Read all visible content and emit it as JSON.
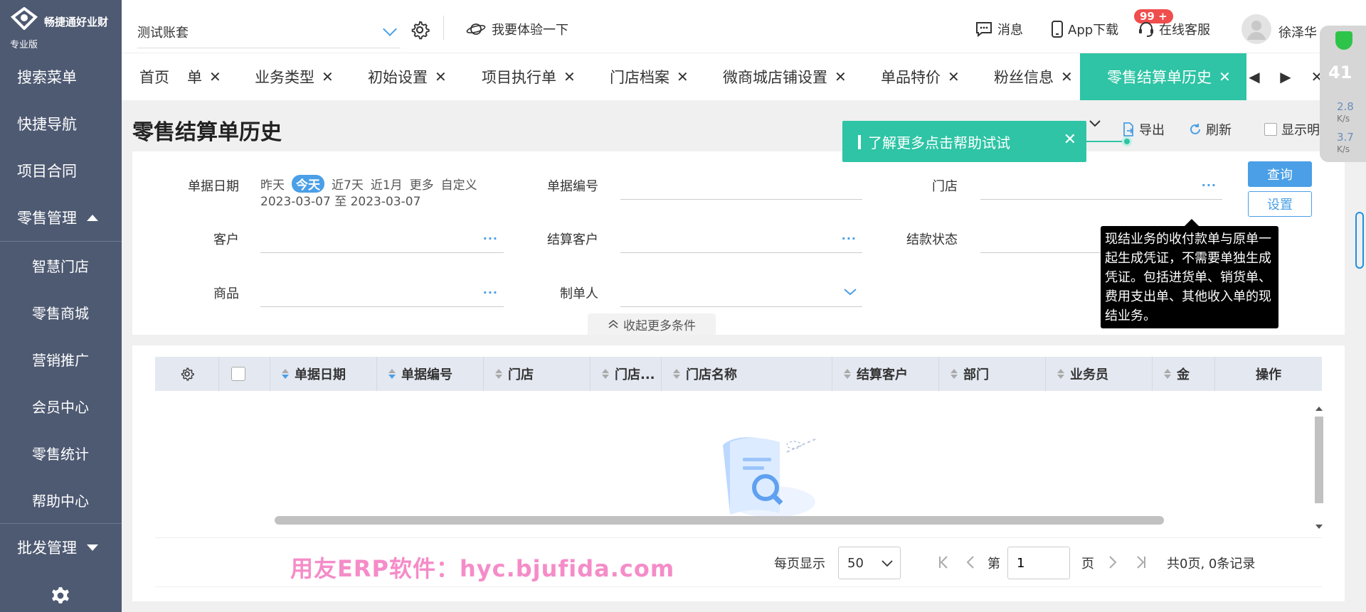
{
  "brand": {
    "name": "畅捷通好业财",
    "edition": "专业版"
  },
  "sidebar": {
    "items": [
      {
        "label": "搜索菜单"
      },
      {
        "label": "快捷导航"
      },
      {
        "label": "项目合同"
      },
      {
        "label": "零售管理"
      },
      {
        "label": "智慧门店"
      },
      {
        "label": "零售商城"
      },
      {
        "label": "营销推广"
      },
      {
        "label": "会员中心"
      },
      {
        "label": "零售统计"
      },
      {
        "label": "帮助中心"
      },
      {
        "label": "批发管理"
      }
    ]
  },
  "header": {
    "account": "测试账套",
    "try": "我要体验一下",
    "messages": "消息",
    "badge": "99 +",
    "app": "App下载",
    "service": "在线客服",
    "user": "徐泽华"
  },
  "tabs": {
    "items": [
      {
        "label": "首页"
      },
      {
        "label": "单"
      },
      {
        "label": "业务类型"
      },
      {
        "label": "初始设置"
      },
      {
        "label": "项目执行单"
      },
      {
        "label": "门店档案"
      },
      {
        "label": "微商城店铺设置"
      },
      {
        "label": "单品特价"
      },
      {
        "label": "粉丝信息"
      },
      {
        "label": "零售结算单历史"
      }
    ]
  },
  "page": {
    "title": "零售结算单历史",
    "export": "导出",
    "refresh": "刷新",
    "show_detail": "显示明细"
  },
  "tip": {
    "text": "了解更多点击帮助试试",
    "close": "✕"
  },
  "filter": {
    "date_label": "单据日期",
    "date_options": [
      "昨天",
      "今天",
      "近7天",
      "近1月",
      "更多",
      "自定义"
    ],
    "date_range": "2023-03-07 至 2023-03-07",
    "doc_no_label": "单据编号",
    "store_label": "门店",
    "customer_label": "客户",
    "settle_customer_label": "结算客户",
    "settle_status_label": "结款状态",
    "product_label": "商品",
    "creator_label": "制单人",
    "query": "查询",
    "setting": "设置",
    "collapse": "收起更多条件",
    "dots": "···"
  },
  "tooltip": "现结业务的收付款单与原单一起生成凭证，不需要单独生成凭证。包括进货单、销货单、费用支出单、其他收入单的现结业务。",
  "table": {
    "columns": [
      "单据日期",
      "单据编号",
      "门店",
      "门店...",
      "门店名称",
      "结算客户",
      "部门",
      "业务员",
      "金",
      "操作"
    ]
  },
  "pager": {
    "watermark": "用友ERP软件：hyc.bjufida.com",
    "per_page": "每页显示",
    "page_size": "50",
    "page_prefix": "第",
    "page_value": "1",
    "page_suffix": "页",
    "summary": "共0页, 0条记录"
  },
  "widget": {
    "value": "41",
    "up": "2.8",
    "down": "3.7",
    "unit": "K/s"
  }
}
